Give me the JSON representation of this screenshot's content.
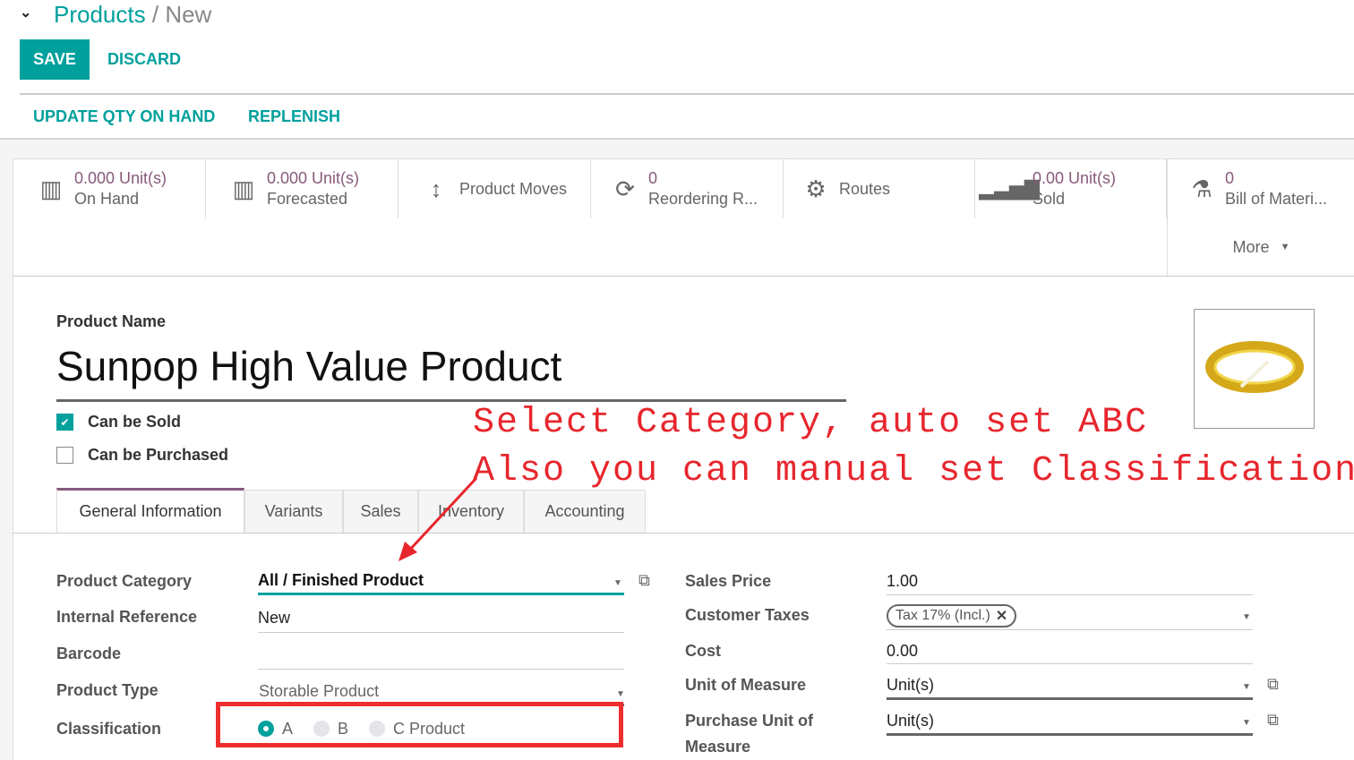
{
  "breadcrumb": {
    "parent": "Products",
    "separator": "/",
    "current": "New"
  },
  "control": {
    "save_label": "SAVE",
    "discard_label": "DISCARD"
  },
  "statusbar": {
    "update_qty_label": "UPDATE QTY ON HAND",
    "replenish_label": "REPLENISH"
  },
  "smart_buttons": [
    {
      "icon": "building-icon",
      "value": "0.000 Unit(s)",
      "label": "On Hand"
    },
    {
      "icon": "building-icon",
      "value": "0.000 Unit(s)",
      "label": "Forecasted"
    },
    {
      "icon": "arrows-vertical-icon",
      "value": "",
      "label": "Product Moves"
    },
    {
      "icon": "refresh-icon",
      "value": "0",
      "label": "Reordering R..."
    },
    {
      "icon": "gears-icon",
      "value": "",
      "label": "Routes"
    },
    {
      "icon": "signal-bars-icon",
      "value": "0.00 Unit(s)",
      "label": "Sold"
    },
    {
      "icon": "flask-icon",
      "value": "0",
      "label": "Bill of Materi..."
    }
  ],
  "more_label": "More",
  "product": {
    "name_label": "Product Name",
    "name": "Sunpop High Value Product",
    "can_be_sold_label": "Can be Sold",
    "can_be_sold": true,
    "can_be_purchased_label": "Can be Purchased",
    "can_be_purchased": false
  },
  "tabs": [
    "General Information",
    "Variants",
    "Sales",
    "Inventory",
    "Accounting"
  ],
  "active_tab": "General Information",
  "left_fields": {
    "category_label": "Product Category",
    "category": "All / Finished Product",
    "internal_ref_label": "Internal Reference",
    "internal_ref": "New",
    "barcode_label": "Barcode",
    "barcode": "",
    "type_label": "Product Type",
    "type": "Storable Product",
    "classification_label": "Classification",
    "classification_options": [
      "A",
      "B",
      "C Product"
    ],
    "classification_selected": "A"
  },
  "right_fields": {
    "sales_price_label": "Sales Price",
    "sales_price": "1.00",
    "customer_taxes_label": "Customer Taxes",
    "customer_tax_tag": "Tax 17% (Incl.)",
    "cost_label": "Cost",
    "cost": "0.00",
    "uom_label": "Unit of Measure",
    "uom": "Unit(s)",
    "purchase_uom_label_1": "Purchase Unit of",
    "purchase_uom_label_2": "Measure",
    "purchase_uom": "Unit(s)"
  },
  "annotation": {
    "line1": "Select Category, auto set ABC",
    "line2": "Also you can manual set Classification ABC.",
    "color": "#e7262d"
  },
  "colors": {
    "primary": "#00a09d",
    "accent": "#875a7b"
  }
}
